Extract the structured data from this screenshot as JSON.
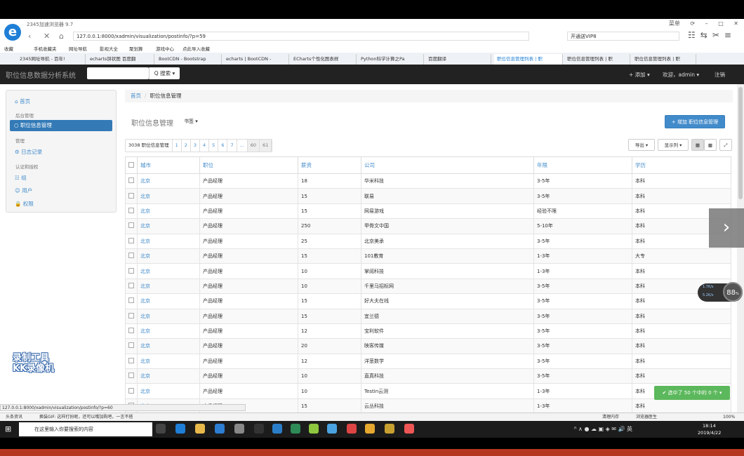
{
  "browser": {
    "name": "2345加速浏览器 9.7",
    "window_controls": [
      "菜单",
      "⟳",
      "–",
      "□",
      "✕"
    ],
    "address": "127.0.0.1:8000/xadmin/visualization/postinfo/?p=59",
    "search_placeholder": "开通送VIP8",
    "favorites": [
      "收藏",
      "手机收藏夹",
      "网址导航",
      "影视大全",
      "聚划算",
      "游戏中心",
      "点此导入收藏"
    ],
    "tabs": [
      "2345网址导航 - 百年!",
      "echarts饼状图 百度翻",
      "BootCDN - Bootstrap",
      "echarts | BootCDN -",
      "ECharts个性化图表样",
      "Python科学计算之Pa",
      "百度翻译",
      "职位信息管理列表 | 职",
      "职位信息管理列表 | 职",
      "职位信息管理列表 | 职"
    ],
    "active_tab": 7
  },
  "app": {
    "title": "职位信息数据分析系统",
    "search_button": "Q 搜索 ▾",
    "nav_add": "+ 添加 ▾",
    "nav_welcome": "欢迎，admin ▾",
    "nav_logout": "注销"
  },
  "sidebar": {
    "home": "首页",
    "section1": "后台管理",
    "active_item": "职位信息管理",
    "section2": "管理",
    "log": "日志记录",
    "section3": "认证和授权",
    "group": "组",
    "user": "用户",
    "perm": "权限"
  },
  "breadcrumb": {
    "home": "首页",
    "current": "职位信息管理"
  },
  "page": {
    "heading": "职位信息管理",
    "bookmark": "书签 ▾",
    "add_button": "+ 增加 职位信息管理",
    "pager_count": "3038 职位信息管理",
    "pages": [
      "1",
      "2",
      "3",
      "4",
      "5",
      "6",
      "7",
      "...",
      "60",
      "61"
    ],
    "export": "导出 ▾",
    "display": "显示列 ▾"
  },
  "table": {
    "headers": [
      "城市",
      "职位",
      "薪资",
      "公司",
      "年限",
      "学历"
    ],
    "rows": [
      [
        "北京",
        "产品经理",
        "18",
        "华米科技",
        "3-5年",
        "本科"
      ],
      [
        "北京",
        "产品经理",
        "15",
        "联易",
        "3-5年",
        "本科"
      ],
      [
        "北京",
        "产品经理",
        "15",
        "网易游戏",
        "经验不限",
        "本科"
      ],
      [
        "北京",
        "产品经理",
        "250",
        "甲骨文中国",
        "5-10年",
        "本科"
      ],
      [
        "北京",
        "产品经理",
        "25",
        "北京美承",
        "3-5年",
        "本科"
      ],
      [
        "北京",
        "产品经理",
        "15",
        "101教育",
        "1-3年",
        "大专"
      ],
      [
        "北京",
        "产品经理",
        "10",
        "掌阅科技",
        "1-3年",
        "本科"
      ],
      [
        "北京",
        "产品经理",
        "10",
        "千里马招标网",
        "3-5年",
        "本科"
      ],
      [
        "北京",
        "产品经理",
        "15",
        "好大夫在线",
        "3-5年",
        "本科"
      ],
      [
        "北京",
        "产品经理",
        "15",
        "宜兰德",
        "3-5年",
        "本科"
      ],
      [
        "北京",
        "产品经理",
        "12",
        "宝利软件",
        "3-5年",
        "本科"
      ],
      [
        "北京",
        "产品经理",
        "20",
        "映客传媒",
        "3-5年",
        "本科"
      ],
      [
        "北京",
        "产品经理",
        "12",
        "洋葱数学",
        "3-5年",
        "本科"
      ],
      [
        "北京",
        "产品经理",
        "10",
        "直真科技",
        "3-5年",
        "本科"
      ],
      [
        "北京",
        "产品经理",
        "10",
        "Testin云测",
        "1-3年",
        "本科"
      ],
      [
        "北京",
        "产品经理",
        "15",
        "云丛科技",
        "1-3年",
        "本科"
      ]
    ]
  },
  "overlay": {
    "next_arrow": "›",
    "speed": "88",
    "speed_unit": "%",
    "net_up": "1.7K/s",
    "net_down": "5.2K/s",
    "selected": "✔ 选中了 50 个中的 0 个 ▾",
    "watermark_line1": "录制工具",
    "watermark_line2": "KK录像机"
  },
  "status": {
    "url": "127.0.0.1:8000/xadmin/visualization/postinfo/?p=60",
    "left": "头条资讯",
    "news": "换装GIF: 这样打扮呢，还可以哦加购吧，一言不搭",
    "protect": "清理内存",
    "download": "浏览器医生",
    "zoom": "100%"
  },
  "taskbar": {
    "search": "在这里输入你要搜索的内容",
    "time": "18:14",
    "date": "2019/4/22"
  },
  "colors": {
    "link": "#428bca",
    "navbar": "#222222",
    "active": "#337ab7",
    "success": "#5cb85c"
  }
}
